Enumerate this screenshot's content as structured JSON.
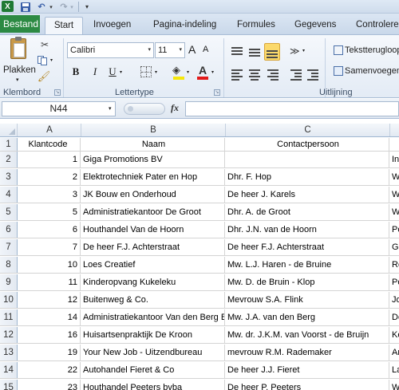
{
  "qat": {
    "logo": "X",
    "undo_glyph": "↶",
    "redo_glyph": "↷",
    "drop_glyph": "▾",
    "more_glyph": "▾"
  },
  "tabs": {
    "file": "Bestand",
    "start": "Start",
    "insert": "Invoegen",
    "layout": "Pagina-indeling",
    "formulas": "Formules",
    "data": "Gegevens",
    "review": "Controleren"
  },
  "ribbon": {
    "clipboard": {
      "paste_label": "Plakken",
      "group_label": "Klembord",
      "icons": [
        "clipboard-icon",
        "scissors-icon",
        "copy-icon",
        "format-painter-icon"
      ]
    },
    "font": {
      "font_name": "Calibri",
      "font_size": "11",
      "grow_glyph": "A",
      "shrink_glyph": "A",
      "bold": "B",
      "italic": "I",
      "underline": "U",
      "fill_glyph": "◈",
      "font_color_glyph": "A",
      "group_label": "Lettertype",
      "fill_color": "#f6e70c",
      "font_color": "#e31a1a"
    },
    "alignment": {
      "orientation_glyph": "≫",
      "wrap_text": "Tekstterugloop",
      "merge": "Samenvoegen",
      "group_label": "Uitlijning",
      "active_color": "#fbd96b"
    }
  },
  "formula_bar": {
    "name_box": "N44",
    "fx": "fx",
    "formula": ""
  },
  "columns": [
    "A",
    "B",
    "C",
    ""
  ],
  "rows": [
    {
      "num": "1",
      "a": "Klantcode",
      "b": "Naam",
      "c": "Contactpersoon",
      "d": ""
    },
    {
      "num": "2",
      "a": "1",
      "b": "Giga Promotions BV",
      "c": "",
      "d": "In"
    },
    {
      "num": "3",
      "a": "2",
      "b": "Elektrotechniek Pater en Hop",
      "c": "Dhr. F. Hop",
      "d": "W"
    },
    {
      "num": "4",
      "a": "3",
      "b": "JK Bouw en Onderhoud",
      "c": "De heer J. Karels",
      "d": "W"
    },
    {
      "num": "5",
      "a": "5",
      "b": "Administratiekantoor De Groot",
      "c": "Dhr. A. de Groot",
      "d": "W"
    },
    {
      "num": "6",
      "a": "6",
      "b": "Houthandel Van de Hoorn",
      "c": "Dhr. J.N. van de Hoorn",
      "d": "Po"
    },
    {
      "num": "7",
      "a": "7",
      "b": "De heer F.J. Achterstraat",
      "c": "De heer F.J. Achterstraat",
      "d": "Gr"
    },
    {
      "num": "8",
      "a": "10",
      "b": "Loes Creatief",
      "c": "Mw. L.J. Haren - de Bruine",
      "d": "Ro"
    },
    {
      "num": "9",
      "a": "11",
      "b": "Kinderopvang Kukeleku",
      "c": "Mw. D. de Bruin - Klop",
      "d": "Po"
    },
    {
      "num": "10",
      "a": "12",
      "b": "Buitenweg & Co.",
      "c": "Mevrouw S.A. Flink",
      "d": "Jo"
    },
    {
      "num": "11",
      "a": "14",
      "b": "Administratiekantoor Van den Berg BV",
      "c": "Mw. J.A. van den Berg",
      "d": "De"
    },
    {
      "num": "12",
      "a": "16",
      "b": "Huisartsenpraktijk De Kroon",
      "c": "Mw. dr. J.K.M. van Voorst - de Bruijn",
      "d": "Ke"
    },
    {
      "num": "13",
      "a": "19",
      "b": "Your New Job - Uitzendbureau",
      "c": "mevrouw R.M. Rademaker",
      "d": "Ar"
    },
    {
      "num": "14",
      "a": "22",
      "b": "Autohandel Fieret & Co",
      "c": "De heer J.J. Fieret",
      "d": "La"
    },
    {
      "num": "15",
      "a": "23",
      "b": "Houthandel Peeters bvba",
      "c": "De heer P. Peeters",
      "d": "W"
    }
  ]
}
